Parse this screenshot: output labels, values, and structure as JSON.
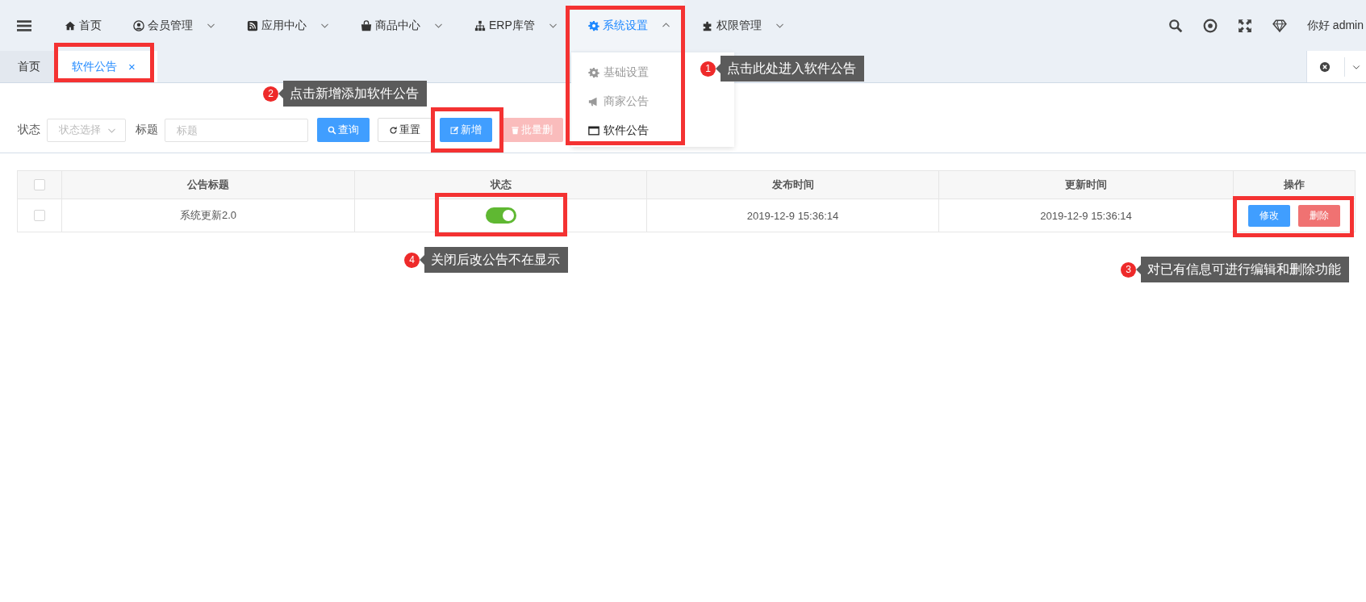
{
  "nav": {
    "items": [
      {
        "label": "首页",
        "kind": "link"
      },
      {
        "label": "会员管理",
        "kind": "menu",
        "expanded": false
      },
      {
        "label": "应用中心",
        "kind": "menu",
        "expanded": false
      },
      {
        "label": "商品中心",
        "kind": "menu",
        "expanded": false
      },
      {
        "label": "ERP库管",
        "kind": "menu",
        "expanded": false
      },
      {
        "label": "系统设置",
        "kind": "menu",
        "expanded": true
      },
      {
        "label": "权限管理",
        "kind": "menu",
        "expanded": false
      }
    ],
    "greeting": "你好 admin"
  },
  "dropdown": [
    {
      "label": "基础设置",
      "selected": false
    },
    {
      "label": "商家公告",
      "selected": false
    },
    {
      "label": "软件公告",
      "selected": true
    }
  ],
  "tabs": [
    {
      "label": "首页",
      "selected": false
    },
    {
      "label": "软件公告",
      "selected": true,
      "close": "×"
    }
  ],
  "filters": [
    {
      "label": "状态",
      "kind": "select",
      "placeholder": "状态选择"
    },
    {
      "label": "标题",
      "kind": "input",
      "placeholder": "标题"
    }
  ],
  "buttons": [
    {
      "label": "查询",
      "kind": "primary",
      "disabled": false
    },
    {
      "label": "重置",
      "kind": "default",
      "disabled": false
    },
    {
      "label": "新增",
      "kind": "primary",
      "disabled": false
    },
    {
      "label": "批量删",
      "kind": "danger",
      "disabled": true
    }
  ],
  "table": {
    "header_checked": false,
    "columns": [
      "公告标题",
      "状态",
      "发布时间",
      "更新时间",
      "操作"
    ],
    "rows": [
      {
        "checked": false,
        "title": "系统更新2.0",
        "on": true,
        "published": "2019-12-9 15:36:14",
        "updated": "2019-12-9 15:36:14",
        "actions": [
          {
            "label": "修改",
            "kind": "edit"
          },
          {
            "label": "删除",
            "kind": "delete"
          }
        ]
      }
    ]
  },
  "annotations": [
    {
      "number": "1",
      "text": "点击此处进入软件公告"
    },
    {
      "number": "2",
      "text": "点击新增添加软件公告"
    },
    {
      "number": "4",
      "text": "关闭后改公告不在显示"
    },
    {
      "number": "3",
      "text": "对已有信息可进行编辑和删除功能"
    }
  ]
}
